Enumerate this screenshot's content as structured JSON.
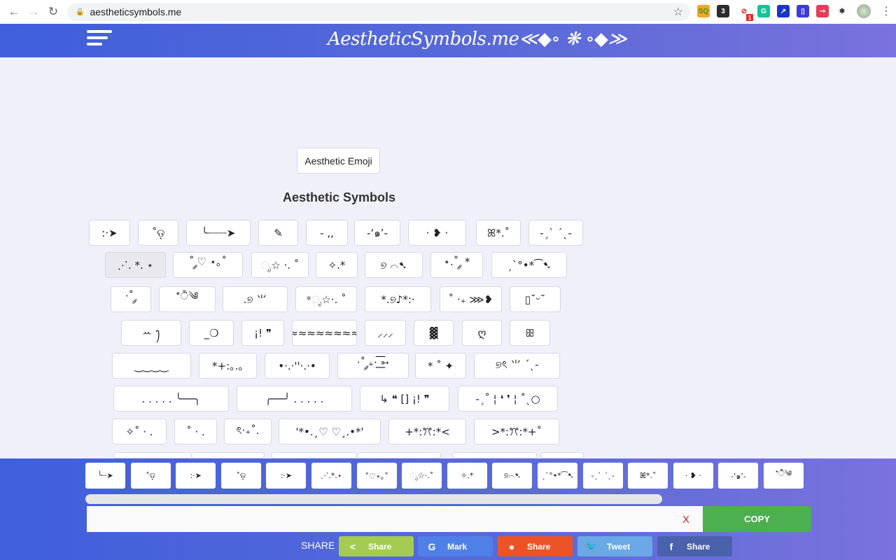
{
  "browser": {
    "url": "aestheticsymbols.me",
    "extensions": [
      {
        "name": "sq",
        "label": "SQ",
        "color": "#f5a623",
        "textColor": "#3a8f2a"
      },
      {
        "name": "three",
        "label": "3",
        "color": "#2d2d2d"
      },
      {
        "name": "blocked",
        "label": "⊘",
        "color": "#ffffff",
        "textColor": "#d93025",
        "badge": "1"
      },
      {
        "name": "grammarly",
        "label": "G",
        "color": "#15c39a"
      },
      {
        "name": "chart",
        "label": "↗",
        "color": "#1a35c9"
      },
      {
        "name": "doc",
        "label": "▯",
        "color": "#3b3bdc"
      },
      {
        "name": "red-ext",
        "label": "⇢",
        "color": "#e0405a"
      },
      {
        "name": "puzzle",
        "label": "✱",
        "color": "#ffffff",
        "textColor": "#333"
      }
    ]
  },
  "header": {
    "title": "AestheticSymbols.me≪◆∘ ❋ ∘◆≫"
  },
  "main": {
    "emoji_button": "Aesthetic Emoji",
    "section_title": "Aesthetic Symbols",
    "rows": [
      [
        ":·➤",
        "˚ଡ଼",
        "╰┈┈┈➤",
        "✎",
        "- ,,",
        "-‘๑’-",
        "· ❥ ·",
        "ꕤ*.˚",
        "-ˏˋ ˊˎ-"
      ],
      [
        "⋰. *. ⋆",
        "˚ ༘♡ ⋆｡˚",
        "ೃ☆ ·. ˚",
        "✧.*",
        "୭ ⌒➷",
        "⋆.˚ ༘ *",
        "ˏˋ°•*⁀➷"
      ],
      [
        "·˚ ༘",
        "*ੈ༄",
        ".୭ ⺌",
        "*ೃ☆·. ˚",
        "*.୭♪*:·",
        "˚ ·₊ ⋙❥",
        "▯˘ᵕ˘"
      ],
      [
        "ꕀ ꫂ",
        "_❍",
        "¡! ❞",
        "≈≈≈≈≈≈≈≈",
        "⸝⸝⸝",
        "▓",
        "ღ",
        "ꕥ"
      ],
      [
        "‿‿‿‿",
        "*+:｡.｡",
        "•·.·''·.·•",
        "·˚ ༘₊· ͟͟͞͞➳",
        "* ˚ ✦",
        "୭ৎ ⺌ ˊˎ-"
      ],
      [
        ". . . . .  ╰──╮",
        "╭──╯  . . . . .",
        "↳ ❝ [] ¡! ❞",
        "-ˏ˚ ¦ ❛ ❜ ¦ ˚ˎ○"
      ],
      [
        "✧˚ · .",
        "˚ · .",
        "ৎ·₊˚.",
        "'*•.¸♡ ♡¸.•*'",
        "+*:ꔫ:*<",
        ">*:ꔫ:*+˚"
      ]
    ],
    "selected": "⋰. *. ⋆"
  },
  "bottom": {
    "recent": [
      "╰┈➤",
      "˚ଡ଼",
      ":·➤",
      "˚ଡ଼",
      ":·➤",
      "⋰.*.⋆",
      "˚♡⋆｡˚",
      "ೃ☆·.˚",
      "✧.*",
      "୭⌒➷",
      "ˏˋ°•*⁀➷",
      "-ˏˋ ˊˎ-",
      "ꕤ*.˚",
      "· ❥ ·",
      "-‘๑’-",
      "*ੈ༄"
    ],
    "copy_input_value": "",
    "clear_label": "X",
    "copy_label": "COPY",
    "share_label": "SHARE",
    "share_buttons": [
      {
        "name": "share-generic",
        "icon": "<",
        "label": "Share",
        "color": "#a4cc52"
      },
      {
        "name": "google-mark",
        "icon": "G",
        "label": "Mark",
        "color": "#4f80e8"
      },
      {
        "name": "reddit-share",
        "icon": "●",
        "label": "Share",
        "color": "#ec5428"
      },
      {
        "name": "twitter-tweet",
        "icon": "🐦",
        "label": "Tweet",
        "color": "#6aa8e6"
      },
      {
        "name": "facebook-share",
        "icon": "f",
        "label": "Share",
        "color": "#4a62ab"
      }
    ]
  }
}
